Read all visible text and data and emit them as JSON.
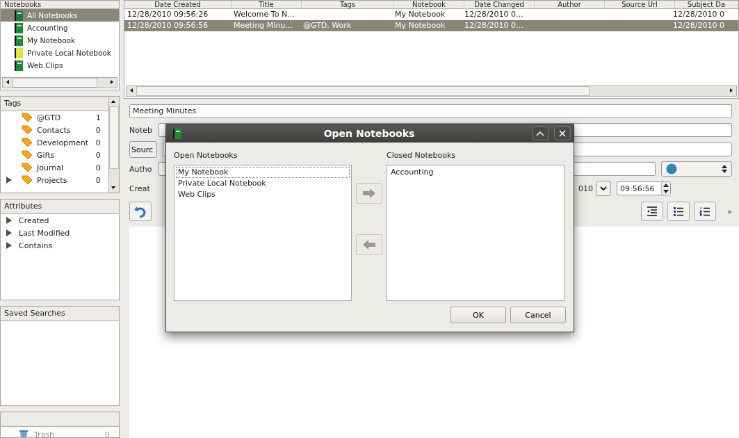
{
  "notebooks": {
    "header": "Notebooks",
    "items": [
      {
        "label": "All Notebooks",
        "selected": true,
        "color": "#1f7a3c"
      },
      {
        "label": "Accounting",
        "selected": false,
        "color": "#1a8c34"
      },
      {
        "label": "My Notebook",
        "selected": false,
        "color": "#1a8c34"
      },
      {
        "label": "Private Local Notebook",
        "selected": false,
        "color": "#e6e22e"
      },
      {
        "label": "Web Clips",
        "selected": false,
        "color": "#1a8c34"
      }
    ]
  },
  "tags": {
    "header": "Tags",
    "items": [
      {
        "label": "@GTD",
        "count": "1",
        "expandable": false
      },
      {
        "label": "Contacts",
        "count": "0",
        "expandable": false
      },
      {
        "label": "Development",
        "count": "0",
        "expandable": false
      },
      {
        "label": "Gifts",
        "count": "0",
        "expandable": false
      },
      {
        "label": "Journal",
        "count": "0",
        "expandable": false
      },
      {
        "label": "Projects",
        "count": "0",
        "expandable": true
      }
    ]
  },
  "attributes": {
    "header": "Attributes",
    "items": [
      "Created",
      "Last Modified",
      "Contains"
    ]
  },
  "saved_searches": {
    "header": "Saved Searches"
  },
  "trash": {
    "label": "Trash",
    "count": "0"
  },
  "note_table": {
    "columns": [
      "Date Created",
      "Title",
      "Tags",
      "Notebook",
      "Date Changed",
      "Author",
      "Source Url",
      "Subject Da"
    ],
    "rows": [
      {
        "selected": false,
        "cells": [
          "12/28/2010 09:56:26",
          "Welcome To N…",
          "",
          "My Notebook",
          "12/28/2010 0…",
          "",
          "",
          "12/28/2010 0"
        ]
      },
      {
        "selected": true,
        "cells": [
          "12/28/2010 09:56:56",
          "Meeting Minu…",
          "@GTD, Work",
          "My Notebook",
          "12/28/2010 0…",
          "",
          "",
          "12/28/2010 0"
        ]
      }
    ]
  },
  "editor": {
    "title_value": "Meeting Minutes",
    "notebook_label": "Noteb",
    "source_button": "Sourc",
    "author_label": "Autho",
    "created_label": "Creat",
    "date_value": "010",
    "time_value": "09:56:56",
    "overflow": "»"
  },
  "dialog": {
    "title": "Open Notebooks",
    "open_label": "Open Notebooks",
    "open_items": [
      {
        "label": "My Notebook",
        "selected": true
      },
      {
        "label": "Private Local Notebook",
        "selected": false
      },
      {
        "label": "Web Clips",
        "selected": false
      }
    ],
    "closed_label": "Closed Notebooks",
    "closed_items": [
      {
        "label": "Accounting",
        "selected": false
      }
    ],
    "buttons": [
      "OK",
      "Cancel"
    ]
  }
}
